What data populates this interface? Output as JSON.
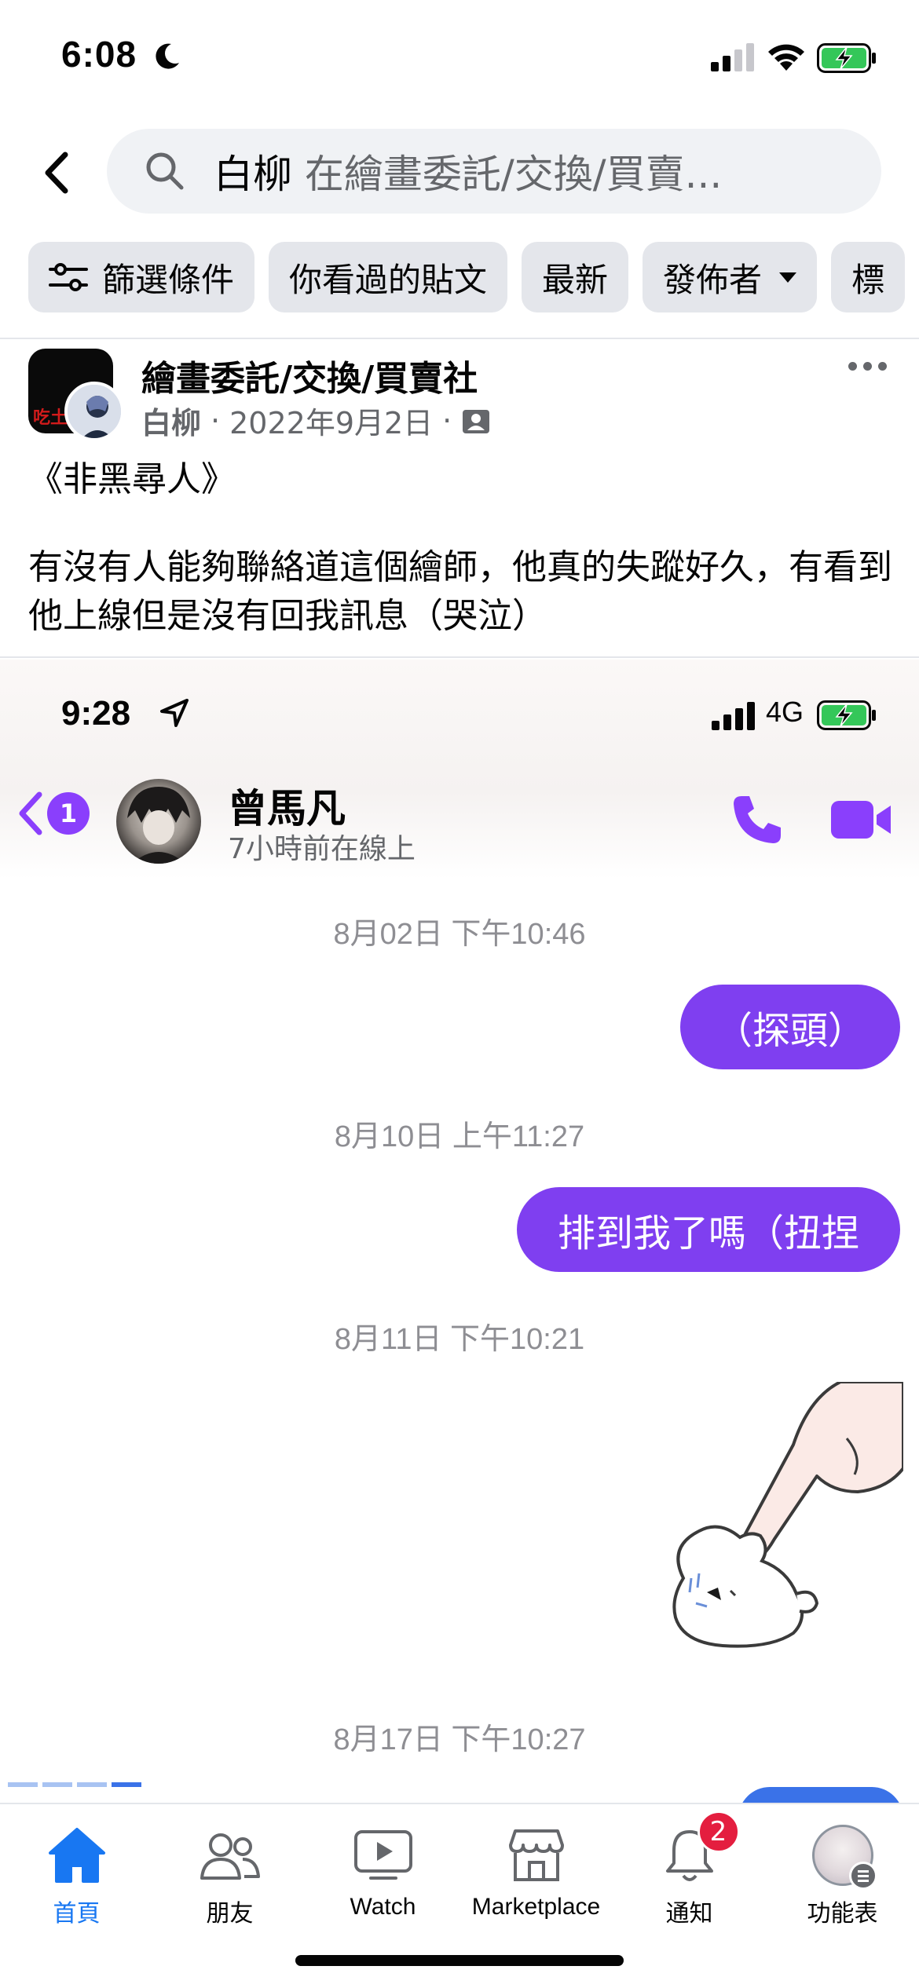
{
  "status_bar": {
    "time": "6:08",
    "icons": [
      "moon-icon",
      "signal-icon",
      "wifi-icon",
      "battery-charging-icon"
    ]
  },
  "search": {
    "keyword": "白柳",
    "query_rest": "在繪畫委託/交換/買賣..."
  },
  "filters": [
    {
      "label": "篩選條件",
      "icon": "sliders-icon"
    },
    {
      "label": "你看過的貼文"
    },
    {
      "label": "最新"
    },
    {
      "label": "發佈者",
      "icon": "caret-down-icon"
    },
    {
      "label": "標"
    }
  ],
  "post": {
    "group": "繪畫委託/交換/買賣社",
    "group_avatar_text": "吃土了",
    "author": "白柳",
    "date": "2022年9月2日",
    "separator": "·",
    "audience_icon": "group-members-icon",
    "title": "《非黑尋人》",
    "body": "有沒有人能夠聯絡道這個繪師，他真的失蹤好久，有看到他上線但是沒有回我訊息（哭泣）"
  },
  "screenshot": {
    "time": "9:28",
    "network": "4G",
    "back_badge": "1",
    "contact_name": "曾馬凡",
    "contact_status": "7小時前在線上",
    "messages": [
      {
        "timestamp": "8月02日 下午10:46",
        "text": "（探頭）"
      },
      {
        "timestamp": "8月10日 上午11:27",
        "text": "排到我了嗎（扭捏"
      },
      {
        "timestamp": "8月11日 下午10:21",
        "sticker": "finger-poking-bunny-sticker"
      },
      {
        "timestamp": "8月17日 下午10:27"
      }
    ]
  },
  "tabbar": {
    "tabs": [
      {
        "label": "首頁",
        "icon": "home-icon",
        "active": true
      },
      {
        "label": "朋友",
        "icon": "friends-icon"
      },
      {
        "label": "Watch",
        "icon": "watch-icon"
      },
      {
        "label": "Marketplace",
        "icon": "marketplace-icon"
      },
      {
        "label": "通知",
        "icon": "bell-icon",
        "badge": "2"
      },
      {
        "label": "功能表",
        "icon": "menu-avatar-icon"
      }
    ]
  },
  "colors": {
    "facebook_blue": "#1877f2",
    "messenger_purple": "#7f3ff0",
    "chip_bg": "#e4e6eb",
    "badge_red": "#e41e3f"
  }
}
